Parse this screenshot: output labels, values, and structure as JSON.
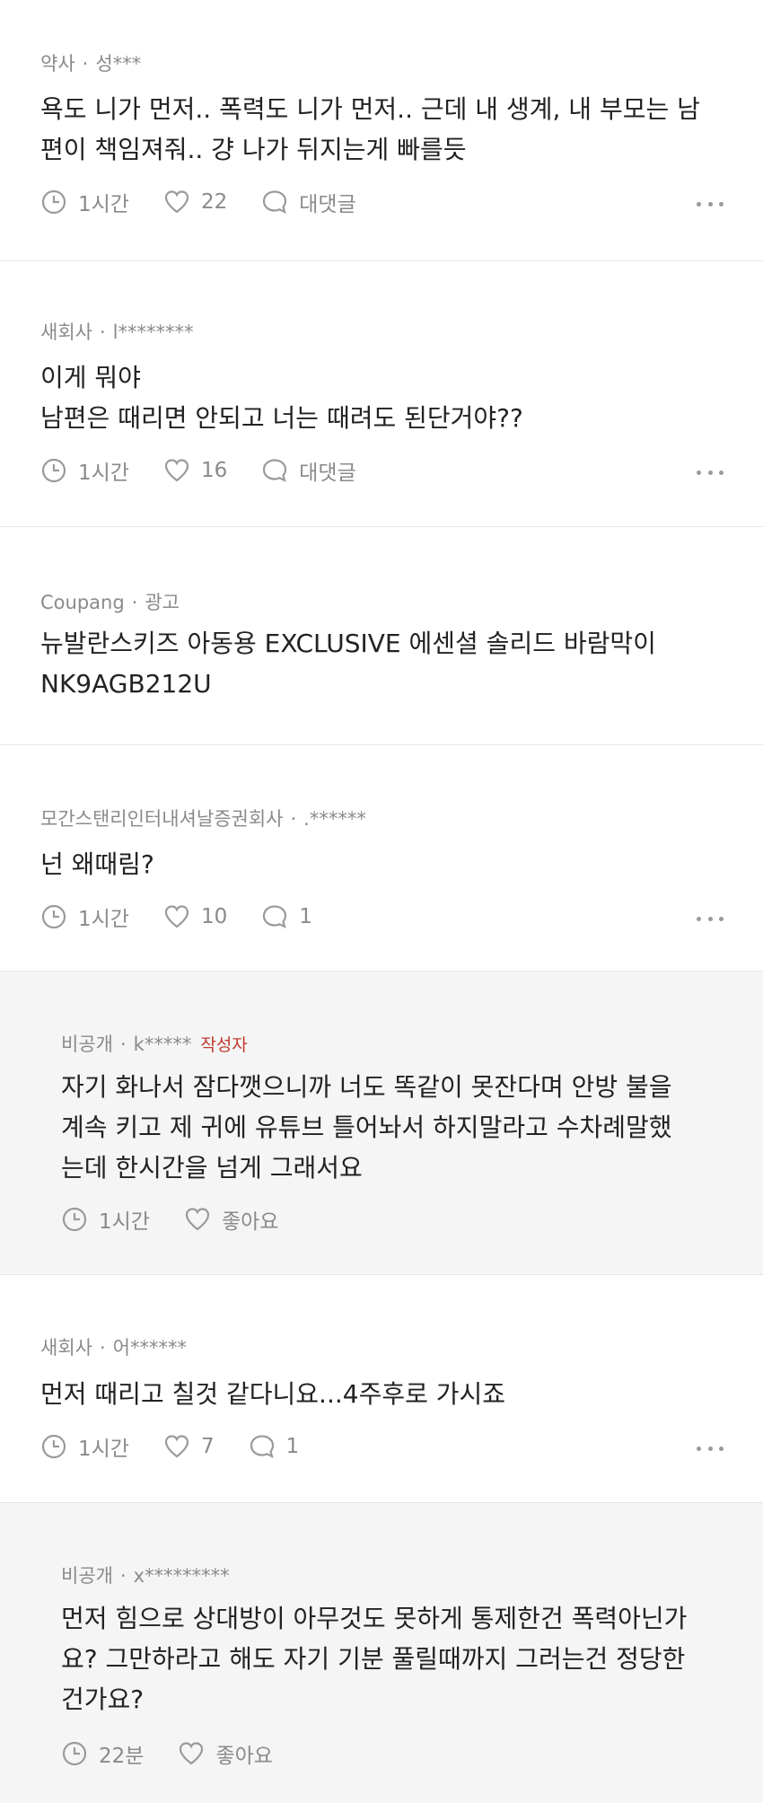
{
  "colors": {
    "author_tag": "#c0392b",
    "reply_background": "#f5f5f5",
    "meta_text": "#8a8a8a"
  },
  "comments": [
    {
      "company": "약사",
      "user": "성***",
      "text": "욕도 니가 먼저.. 폭력도 니가 먼저.. 근데 내 생계, 내 부모는 남\n편이 책임져줘.. 걍 나가 뒤지는게 빠를듯",
      "time": "1시간",
      "likes": "22",
      "reply_label": "대댓글"
    },
    {
      "company": "새회사",
      "user": "l********",
      "text": "이게 뭐야\n남편은 때리면 안되고 너는 때려도 된단거야??",
      "time": "1시간",
      "likes": "16",
      "reply_label": "대댓글"
    },
    {
      "company": "Coupang",
      "user": "광고",
      "text": "뉴발란스키즈 아동용 EXCLUSIVE 에센셜 솔리드 바람막이\nNK9AGB212U"
    },
    {
      "company": "모간스탠리인터내셔날증권회사",
      "user": ".******",
      "text": "넌 왜때림?",
      "time": "1시간",
      "likes": "10",
      "reply_label": "1"
    },
    {
      "company": "비공개",
      "user": "k*****",
      "author_tag": "작성자",
      "text": "자기 화나서 잠다깻으니까 너도 똑같이 못잔다며 안방 불을\n계속 키고 제 귀에 유튜브 틀어놔서 하지말라고 수차례말했\n는데 한시간을 넘게 그래서요",
      "time": "1시간",
      "likes": "좋아요"
    },
    {
      "company": "새회사",
      "user": "어******",
      "text": "먼저 때리고 칠것 같다니요...4주후로 가시죠",
      "time": "1시간",
      "likes": "7",
      "reply_label": "1"
    },
    {
      "company": "비공개",
      "user": "x*********",
      "text": "먼저 힘으로 상대방이 아무것도 못하게 통제한건 폭력아닌가\n요? 그만하라고 해도 자기 기분 풀릴때까지 그러는건 정당한\n건가요?",
      "time": "22분",
      "likes": "좋아요"
    }
  ],
  "icons": {
    "time": "clock-icon",
    "like": "heart-icon",
    "reply": "speech-bubble-icon",
    "more": "more-dots-icon"
  }
}
